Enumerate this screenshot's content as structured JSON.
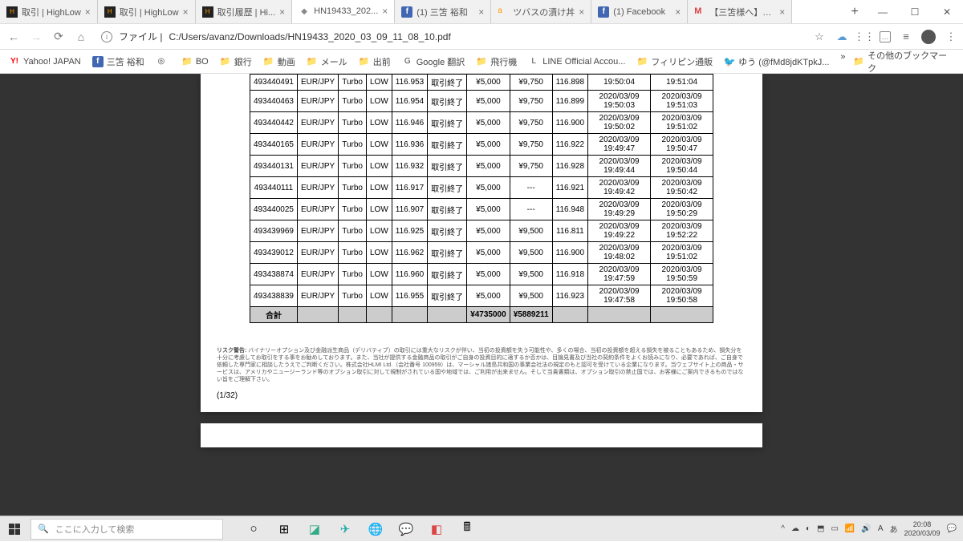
{
  "tabs": [
    {
      "icon": "hl",
      "label": "取引 | HighLow"
    },
    {
      "icon": "hl",
      "label": "取引 | HighLow"
    },
    {
      "icon": "hl",
      "label": "取引履歴 | Hi..."
    },
    {
      "icon": "pdf",
      "label": "HN19433_202...",
      "active": true
    },
    {
      "icon": "fb",
      "label": "(1) 三笘 裕和"
    },
    {
      "icon": "az",
      "label": "ツバスの漬け丼"
    },
    {
      "icon": "fb",
      "label": "(1) Facebook"
    },
    {
      "icon": "gm",
      "label": "【三笘様へ】ご..."
    }
  ],
  "url_prefix": "ファイル |",
  "url": "C:/Users/avanz/Downloads/HN19433_2020_03_09_11_08_10.pdf",
  "bookmarks": [
    {
      "icon": "Y",
      "label": "Yahoo! JAPAN",
      "cls": "y"
    },
    {
      "icon": "f",
      "label": "三笘 裕和",
      "cls": "fb"
    },
    {
      "icon": "◎",
      "label": "",
      "cls": ""
    },
    {
      "icon": "📁",
      "label": "BO",
      "cls": "fold"
    },
    {
      "icon": "📁",
      "label": "銀行",
      "cls": "fold"
    },
    {
      "icon": "📁",
      "label": "動画",
      "cls": "fold"
    },
    {
      "icon": "📁",
      "label": "メール",
      "cls": "fold"
    },
    {
      "icon": "📁",
      "label": "出前",
      "cls": "fold"
    },
    {
      "icon": "G",
      "label": "Google 翻訳",
      "cls": ""
    },
    {
      "icon": "📁",
      "label": "飛行機",
      "cls": "fold"
    },
    {
      "icon": "L",
      "label": "LINE Official Accou...",
      "cls": ""
    },
    {
      "icon": "📁",
      "label": "フィリピン通販",
      "cls": "fold"
    },
    {
      "icon": "🐦",
      "label": "ゆう (@fMd8jdKTpkJ...",
      "cls": "tw"
    }
  ],
  "bookmarks_more": "その他のブックマーク",
  "rows": [
    [
      "493440491",
      "EUR/JPY",
      "Turbo",
      "LOW",
      "116.953",
      "取引終了",
      "¥5,000",
      "¥9,750",
      "116.898",
      "19:50:04",
      "19:51:04"
    ],
    [
      "493440463",
      "EUR/JPY",
      "Turbo",
      "LOW",
      "116.954",
      "取引終了",
      "¥5,000",
      "¥9,750",
      "116.899",
      "2020/03/09\n19:50:03",
      "2020/03/09\n19:51:03"
    ],
    [
      "493440442",
      "EUR/JPY",
      "Turbo",
      "LOW",
      "116.946",
      "取引終了",
      "¥5,000",
      "¥9,750",
      "116.900",
      "2020/03/09\n19:50:02",
      "2020/03/09\n19:51:02"
    ],
    [
      "493440165",
      "EUR/JPY",
      "Turbo",
      "LOW",
      "116.936",
      "取引終了",
      "¥5,000",
      "¥9,750",
      "116.922",
      "2020/03/09\n19:49:47",
      "2020/03/09\n19:50:47"
    ],
    [
      "493440131",
      "EUR/JPY",
      "Turbo",
      "LOW",
      "116.932",
      "取引終了",
      "¥5,000",
      "¥9,750",
      "116.928",
      "2020/03/09\n19:49:44",
      "2020/03/09\n19:50:44"
    ],
    [
      "493440111",
      "EUR/JPY",
      "Turbo",
      "LOW",
      "116.917",
      "取引終了",
      "¥5,000",
      "---",
      "116.921",
      "2020/03/09\n19:49:42",
      "2020/03/09\n19:50:42"
    ],
    [
      "493440025",
      "EUR/JPY",
      "Turbo",
      "LOW",
      "116.907",
      "取引終了",
      "¥5,000",
      "---",
      "116.948",
      "2020/03/09\n19:49:29",
      "2020/03/09\n19:50:29"
    ],
    [
      "493439969",
      "EUR/JPY",
      "Turbo",
      "LOW",
      "116.925",
      "取引終了",
      "¥5,000",
      "¥9,500",
      "116.811",
      "2020/03/09\n19:49:22",
      "2020/03/09\n19:52:22"
    ],
    [
      "493439012",
      "EUR/JPY",
      "Turbo",
      "LOW",
      "116.962",
      "取引終了",
      "¥5,000",
      "¥9,500",
      "116.900",
      "2020/03/09\n19:48:02",
      "2020/03/09\n19:51:02"
    ],
    [
      "493438874",
      "EUR/JPY",
      "Turbo",
      "LOW",
      "116.960",
      "取引終了",
      "¥5,000",
      "¥9,500",
      "116.918",
      "2020/03/09\n19:47:59",
      "2020/03/09\n19:50:59"
    ],
    [
      "493438839",
      "EUR/JPY",
      "Turbo",
      "LOW",
      "116.955",
      "取引終了",
      "¥5,000",
      "¥9,500",
      "116.923",
      "2020/03/09\n19:47:58",
      "2020/03/09\n19:50:58"
    ]
  ],
  "sum": {
    "label": "合計",
    "c7": "¥4735000",
    "c8": "¥5889211"
  },
  "disclaimer_label": "リスク警告:",
  "disclaimer": "バイナリーオプション及び金融派生商品（デリバティブ）の取引には重大なリスクが伴い、当初の投資額を失う可能性や、多くの場合、当初の投資額を超える損失を被ることもあるため、損失分を十分に考慮してお取引をする事をお勧めしております。また、当社が提供する金融商品の取引がご自身の投資目的に適するか否かは、目論見書及び当社の契約条件をよくお読みになり、必要であれば、ご自身で依頼した専門家に相談したうえでご判断ください。株式会社HLMI Ltd.（会社番号 100959）は、マーシャル諸島共和国の事業会社法の規定のもと認可を受けている企業になります。当ウェブサイト上の商品・サービスは、アメリカやニュージーランド等のオプション取引に対して規制がされている国や地域では、ご利用が出来ません。そして当貴書類は、オプション取引の禁止国では、お客様にご案内できるものではない旨をご理解下さい。",
  "page_indicator": "(1/32)",
  "search_placeholder": "ここに入力して検索",
  "clock": {
    "time": "20:08",
    "date": "2020/03/09"
  }
}
